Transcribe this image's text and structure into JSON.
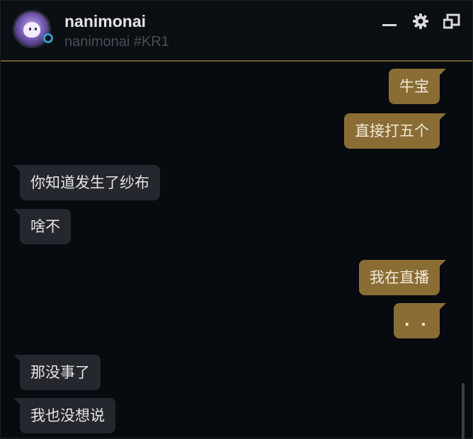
{
  "header": {
    "username": "nanimonai",
    "tagline": "nanimonai #KR1",
    "icons": {
      "avatar": "avatar",
      "status": "online-status-dot",
      "minimize": "minimize-icon",
      "settings": "gear-icon",
      "popout": "popout-icon"
    }
  },
  "colors": {
    "outgoing_bubble": "#8a6d35",
    "incoming_bubble": "#24272d",
    "accent_line": "#6e5b33",
    "status": "#2f9fc9"
  },
  "messages": [
    {
      "from": "me",
      "text": "牛宝"
    },
    {
      "from": "me",
      "text": "直接打五个"
    },
    {
      "from": "them",
      "text": "你知道发生了纱布"
    },
    {
      "from": "them",
      "text": "啥不"
    },
    {
      "from": "me",
      "text": "我在直播"
    },
    {
      "from": "me",
      "text": ". ."
    },
    {
      "from": "them",
      "text": "那没事了"
    },
    {
      "from": "them",
      "text": "我也没想说"
    }
  ]
}
